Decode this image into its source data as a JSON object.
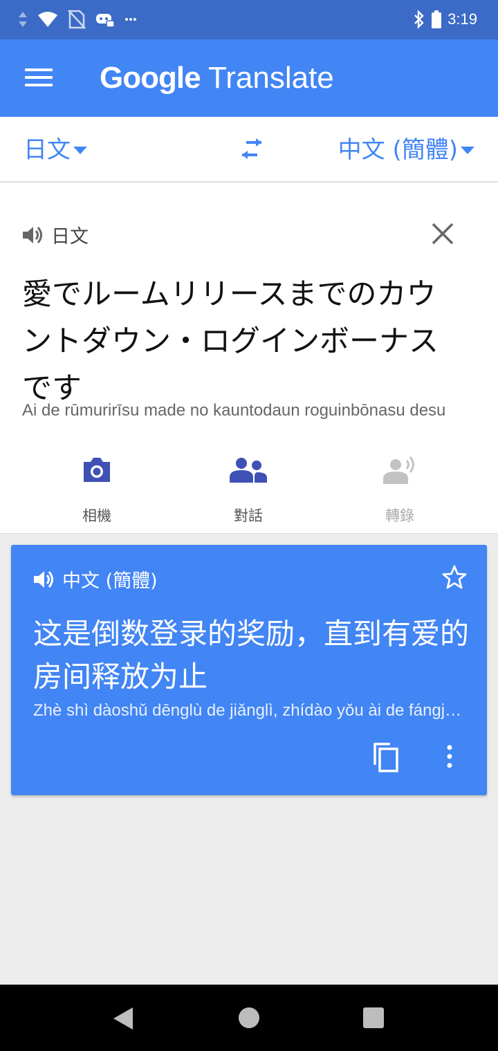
{
  "status_bar": {
    "time": "3:19"
  },
  "app_bar": {
    "title_brand": "Google",
    "title_product": "Translate"
  },
  "languages": {
    "source": "日文",
    "target": "中文 (簡體)"
  },
  "input": {
    "label": "日文",
    "text": "愛でルームリリースまでのカウントダウン・ログインボーナスです",
    "transliteration": "Ai de rūmurirīsu made no kauntodaun roguinbōnasu desu"
  },
  "tools": [
    {
      "label": "相機",
      "icon": "camera-icon"
    },
    {
      "label": "對話",
      "icon": "conversation-icon"
    },
    {
      "label": "轉錄",
      "icon": "transcribe-icon"
    }
  ],
  "output": {
    "label": "中文 (簡體)",
    "text": "这是倒数登录的奖励，直到有爱的房间释放为止",
    "transliteration": "Zhè shì dàoshǔ dēnglù de jiǎnglì, zhídào yǒu ài de fángjiān shìfàng wéizhǐ"
  },
  "colors": {
    "primary": "#4285f4",
    "status_bar": "#3b6bc6",
    "background": "#ececec"
  }
}
